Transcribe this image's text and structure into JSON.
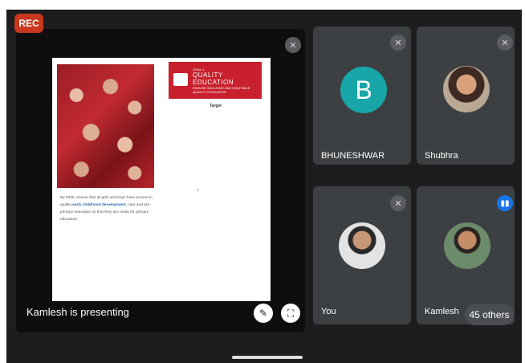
{
  "recording_badge": "REC",
  "main": {
    "presenter_label": "Kamlesh is presenting",
    "slide": {
      "logo_small": "GOAL 4",
      "logo_title": "QUALITY EDUCATION",
      "logo_sub": "ENSURE INCLUSIVE AND EQUITABLE QUALITY EDUCATION",
      "target_label": "Target",
      "bullet_lead": "By 2030, ensure that all girls and boys have access to quality",
      "bullet_emphasis": "early childhood development",
      "bullet_tail": ", care and pre-primary education so that they are ready for primary education",
      "cursor_glyph": "›"
    },
    "unpin_icon": "pin-off-icon",
    "fullscreen_icon": "fullscreen-icon"
  },
  "participants": [
    {
      "name": "BHUNESHWAR",
      "avatar_letter": "B",
      "avatar_color": "#18a6a8",
      "status": "muted"
    },
    {
      "name": "Shubhra",
      "status": "muted"
    },
    {
      "name": "You",
      "status": "muted"
    },
    {
      "name": "Kamlesh",
      "status": "speaking"
    }
  ],
  "others_count": "45 others",
  "colors": {
    "rec": "#c8371e",
    "tile": "#3c4043",
    "speaking": "#1a73e8",
    "slide_banner": "#c8202d"
  }
}
